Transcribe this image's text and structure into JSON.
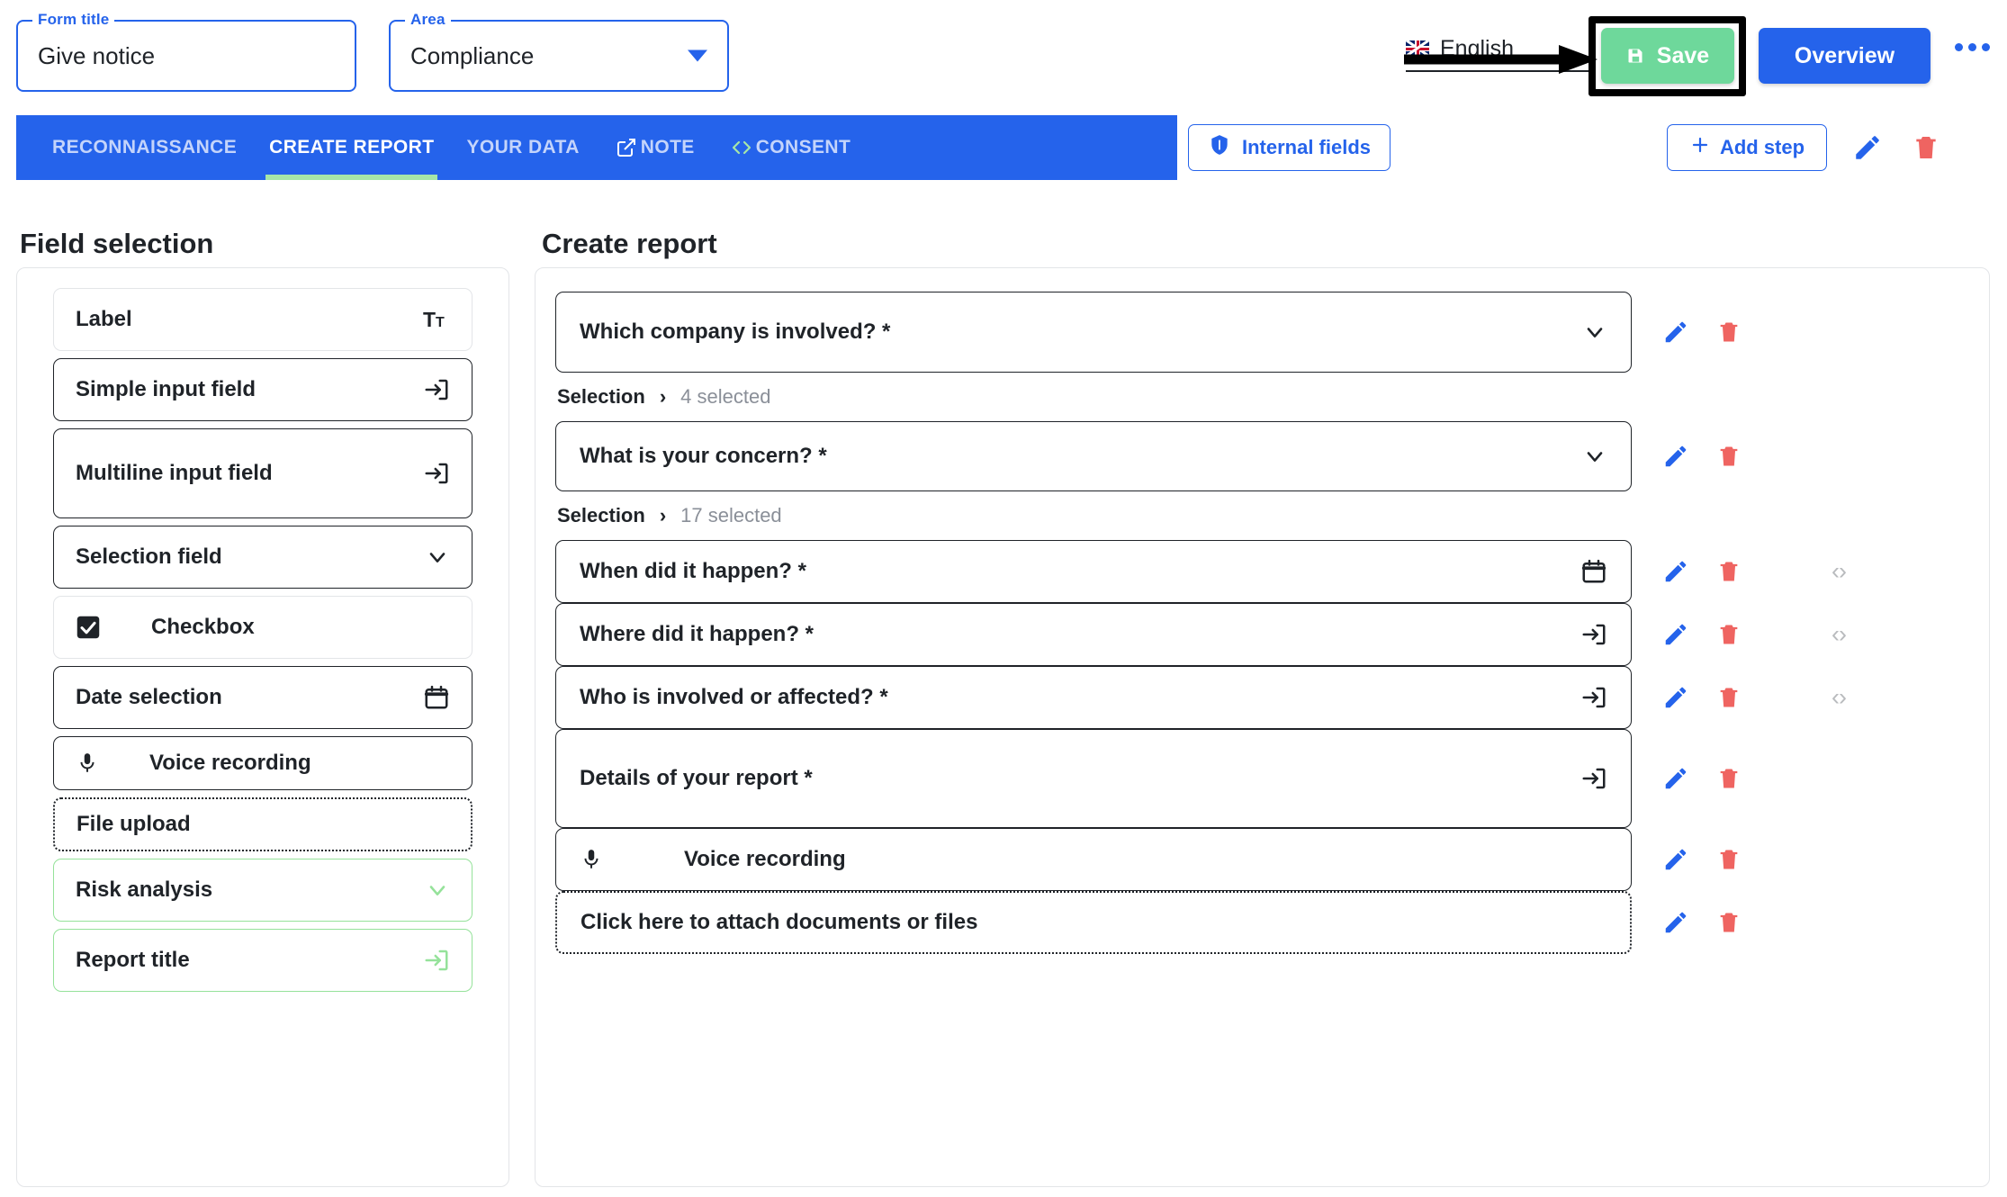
{
  "topbar": {
    "form_title": {
      "legend": "Form title",
      "value": "Give notice"
    },
    "area": {
      "legend": "Area",
      "value": "Compliance"
    },
    "language": {
      "value": "English",
      "flag": "uk-flag-icon"
    },
    "save_label": "Save",
    "overview_label": "Overview",
    "more_label": "•••"
  },
  "tabs": [
    {
      "label": "RECONNAISSANCE",
      "active": false,
      "icon": null
    },
    {
      "label": "CREATE REPORT",
      "active": true,
      "icon": null
    },
    {
      "label": "YOUR DATA",
      "active": false,
      "icon": null
    },
    {
      "label": "NOTE",
      "active": false,
      "icon": "external-link-icon"
    },
    {
      "label": "CONSENT",
      "active": false,
      "icon": "code-brackets-icon"
    }
  ],
  "toolbar": {
    "internal_fields_label": "Internal fields",
    "internal_fields_icon": "shield-icon",
    "add_step_label": "Add step",
    "add_step_icon": "plus-icon",
    "edit_icon": "pencil-icon",
    "delete_icon": "trash-icon"
  },
  "left_panel": {
    "title": "Field selection",
    "items": [
      {
        "label": "Label",
        "icon": "text-format-icon",
        "border": "b-light",
        "height": "fc-h70",
        "lead": false
      },
      {
        "label": "Simple input field",
        "icon": "input-field-icon",
        "border": "b-dark",
        "height": "fc-h70",
        "lead": false
      },
      {
        "label": "Multiline input field",
        "icon": "input-field-icon",
        "border": "b-dark",
        "height": "fc-h100",
        "lead": false
      },
      {
        "label": "Selection field",
        "icon": "chevron-down-icon",
        "border": "b-dark",
        "height": "fc-h70",
        "lead": false
      },
      {
        "label": "Checkbox",
        "icon": "checkbox-checked-icon",
        "border": "b-light",
        "height": "fc-h70",
        "lead": true
      },
      {
        "label": "Date selection",
        "icon": "calendar-icon",
        "border": "b-dark",
        "height": "fc-h70",
        "lead": false
      },
      {
        "label": "Voice recording",
        "icon": "microphone-icon",
        "border": "b-dark",
        "height": "fc-h60",
        "lead": true
      },
      {
        "label": "File upload",
        "icon": null,
        "border": "b-dotted",
        "height": "fc-h60",
        "lead": false
      },
      {
        "label": "Risk analysis",
        "icon": "chevron-down-green-icon",
        "border": "b-green",
        "height": "fc-h70",
        "lead": false
      },
      {
        "label": "Report title",
        "icon": "input-field-green-icon",
        "border": "b-green",
        "height": "fc-h70",
        "lead": false
      }
    ]
  },
  "right_panel": {
    "title": "Create report",
    "rows": [
      {
        "kind": "field",
        "label": "Which company is involved? *",
        "icon": "chevron-down-icon",
        "border": "b-dark",
        "height": "q-h90",
        "lead": false,
        "code": false
      },
      {
        "kind": "note",
        "sn_label": "Selection",
        "sn_chev": "›",
        "sn_count": "4 selected"
      },
      {
        "kind": "field",
        "label": "What is your concern? *",
        "icon": "chevron-down-icon",
        "border": "b-dark",
        "height": "q-h78",
        "lead": false,
        "code": false
      },
      {
        "kind": "note",
        "sn_label": "Selection",
        "sn_chev": "›",
        "sn_count": "17 selected"
      },
      {
        "kind": "field",
        "label": "When did it happen? *",
        "icon": "calendar-icon",
        "border": "b-dark",
        "height": "q-h70",
        "lead": false,
        "code": true
      },
      {
        "kind": "field",
        "label": "Where did it happen? *",
        "icon": "input-field-icon",
        "border": "b-dark",
        "height": "q-h70",
        "lead": false,
        "code": true
      },
      {
        "kind": "field",
        "label": "Who is involved or affected? *",
        "icon": "input-field-icon",
        "border": "b-dark",
        "height": "q-h70",
        "lead": false,
        "code": true
      },
      {
        "kind": "field",
        "label": "Details of your report *",
        "icon": "input-field-icon",
        "border": "b-dark",
        "height": "q-h110",
        "lead": false,
        "code": false
      },
      {
        "kind": "field",
        "label": "Voice recording",
        "icon": null,
        "lead_icon": "microphone-icon",
        "border": "b-dark",
        "height": "q-h70",
        "lead": true,
        "code": false
      },
      {
        "kind": "field",
        "label": "Click here to attach documents or files",
        "icon": null,
        "border": "b-dotted",
        "height": "q-h70",
        "lead": false,
        "code": false
      }
    ],
    "row_edit_icon": "pencil-icon",
    "row_delete_icon": "trash-icon",
    "row_code_icon": "code-brackets-icon"
  },
  "colors": {
    "brand_blue": "#2563eb",
    "save_green": "#6ed89b",
    "accent_green": "#95e29a",
    "delete_red": "#ef6461",
    "muted_gray": "#8a8f98"
  }
}
